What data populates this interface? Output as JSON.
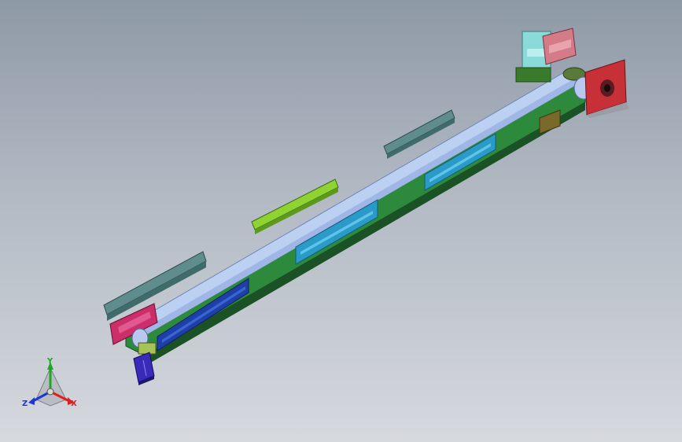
{
  "viewport": {
    "background_top": "#8e99a6",
    "background_bottom": "#d6d9de"
  },
  "model": {
    "frame_color": "#2f7d3a",
    "frame_dark": "#1f5a2a",
    "belt_color": "#b8c8ee",
    "guard_color": "#5c8a8a",
    "guard_highlight": "#9ad53a",
    "sensor_panel_color": "#2a9ac8",
    "motor_block_color": "#c0394a",
    "bracket_color": "#d98a9a",
    "cylinder_color": "#8adada",
    "actuator_color": "#4a32c8"
  },
  "triad": {
    "x_label": "X",
    "y_label": "Y",
    "z_label": "Z",
    "x_color": "#e0201c",
    "y_color": "#1fa81f",
    "z_color": "#1c37d6"
  }
}
